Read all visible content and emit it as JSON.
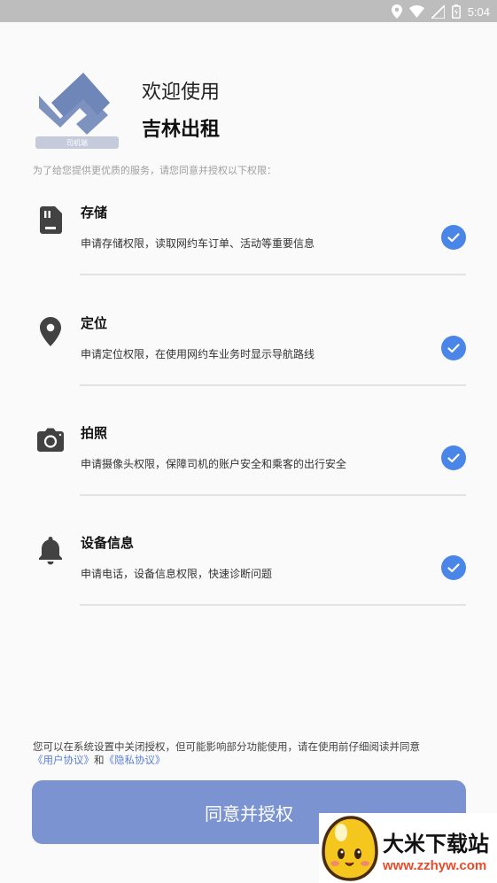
{
  "status_bar": {
    "time": "5:04",
    "icons": [
      "location-icon",
      "wifi-icon",
      "signal-icon",
      "battery-icon"
    ]
  },
  "header": {
    "welcome": "欢迎使用",
    "app_name": "吉林出租",
    "logo_caption": "司机端"
  },
  "intro": "为了给您提供更优质的服务，请您同意并授权以下权限：",
  "permissions": [
    {
      "icon": "sd-card-icon",
      "title": "存储",
      "desc": "申请存储权限，读取网约车订单、活动等重要信息",
      "checked": true
    },
    {
      "icon": "location-pin-icon",
      "title": "定位",
      "desc": "申请定位权限，在使用网约车业务时显示导航路线",
      "checked": true
    },
    {
      "icon": "camera-icon",
      "title": "拍照",
      "desc": "申请摄像头权限，保障司机的账户安全和乘客的出行安全",
      "checked": true
    },
    {
      "icon": "bell-icon",
      "title": "设备信息",
      "desc": "申请电话，设备信息权限，快速诊断问题",
      "checked": true
    }
  ],
  "notice": {
    "text": "您可以在系统设置中关闭授权，但可能影响部分功能使用，请在使用前仔细阅读并同意",
    "user_agreement": "《用户协议》",
    "and": "和",
    "privacy_agreement": "《隐私协议》"
  },
  "agree_button": "同意并授权",
  "watermark": {
    "title": "大米下载站",
    "url": "www.zzhyw.com"
  },
  "colors": {
    "accent": "#4a86e8",
    "button": "#7b93d0",
    "link": "#5b7fd6",
    "status_bar": "#bdbdbd",
    "watermark_url": "#e84b2b"
  }
}
